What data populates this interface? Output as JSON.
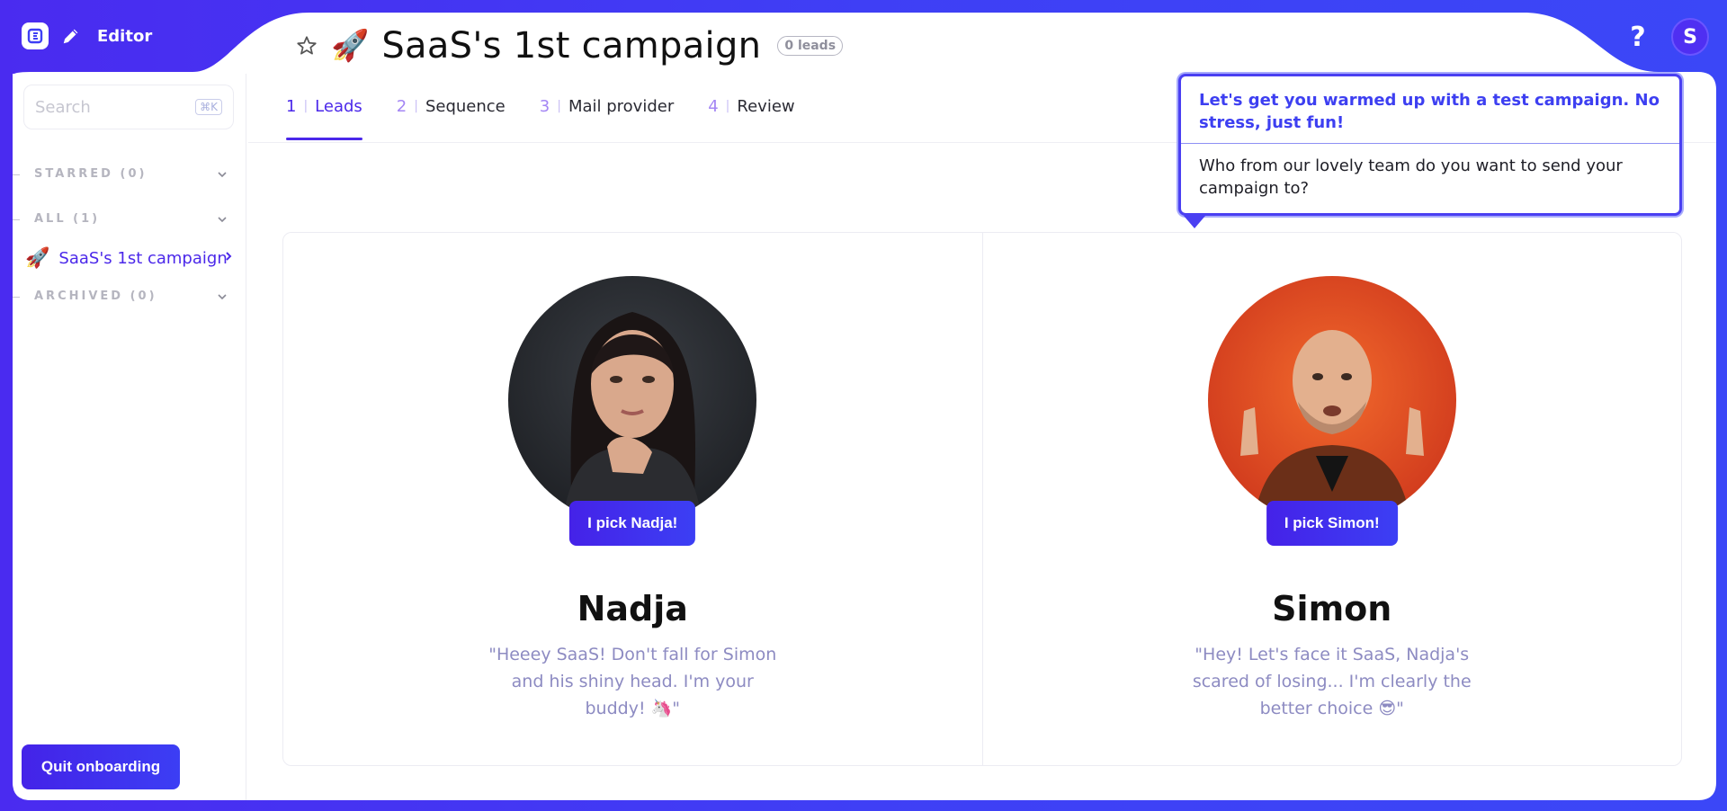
{
  "app": {
    "name": "Editor",
    "help_label": "?",
    "avatar_initial": "S"
  },
  "campaign": {
    "emoji": "🚀",
    "title": "SaaS's 1st campaign",
    "leads_badge": "0 leads"
  },
  "sidebar": {
    "search_placeholder": "Search",
    "search_shortcut": "⌘K",
    "sections": [
      {
        "label": "STARRED (0)"
      },
      {
        "label": "ALL (1)"
      },
      {
        "label": "ARCHIVED (0)"
      }
    ],
    "campaign_item": {
      "emoji": "🚀",
      "label": "SaaS's 1st campaign"
    },
    "quit_label": "Quit onboarding"
  },
  "tabs": [
    {
      "num": "1",
      "label": "Leads",
      "active": true
    },
    {
      "num": "2",
      "label": "Sequence"
    },
    {
      "num": "3",
      "label": "Mail provider"
    },
    {
      "num": "4",
      "label": "Review"
    }
  ],
  "tooltip": {
    "headline": "Let's get you warmed up with a test campaign. No stress, just fun!",
    "body": "Who from our lovely team do you want to send your campaign to?"
  },
  "leads": [
    {
      "name": "Nadja",
      "button": "I pick Nadja!",
      "quote": "\"Heeey SaaS! Don't fall for Simon and his shiny head. I'm your buddy! 🦄\""
    },
    {
      "name": "Simon",
      "button": "I pick Simon!",
      "quote": "\"Hey! Let's face it SaaS, Nadja's scared of losing... I'm clearly the better choice 😎\""
    }
  ],
  "colors": {
    "brand": "#4b28ea",
    "background": "#3f3ff5"
  }
}
